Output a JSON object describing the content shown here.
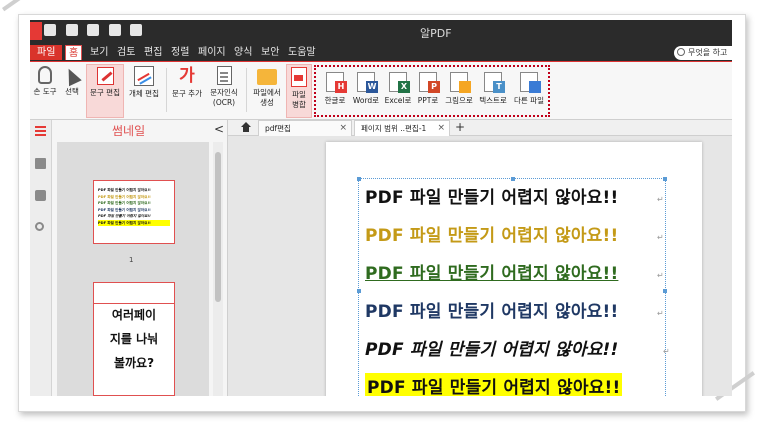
{
  "app": {
    "title": "알PDF"
  },
  "menu": {
    "file": "파일",
    "items": [
      "홈",
      "보기",
      "검토",
      "편집",
      "정렬",
      "페이지",
      "양식",
      "보안",
      "도움말"
    ],
    "active": "홈",
    "search_placeholder": "무엇을 하고"
  },
  "ribbon": {
    "hand_tool": "손 도구",
    "select": "선택",
    "text_edit": "문구 편집",
    "object_edit": "개체 편집",
    "add_text": "문구 추가",
    "ocr_line1": "문자인식",
    "ocr_line2": "(OCR)",
    "create_line1": "파일에서",
    "create_line2": "생성",
    "merge_line1": "파일",
    "merge_line2": "병합",
    "add_text_icon": "가"
  },
  "convert": [
    {
      "label": "한글로",
      "badge": "H",
      "color": "#e53935"
    },
    {
      "label": "Word로",
      "badge": "W",
      "color": "#2b579a"
    },
    {
      "label": "Excel로",
      "badge": "X",
      "color": "#217346"
    },
    {
      "label": "PPT로",
      "badge": "P",
      "color": "#d24726"
    },
    {
      "label": "그림으로",
      "badge": "",
      "color": "#f5a623"
    },
    {
      "label": "텍스트로",
      "badge": "T",
      "color": "#4a90c8"
    },
    {
      "label": "다른 파일",
      "badge": "",
      "color": "#3a7bd5"
    }
  ],
  "thumbnails": {
    "title": "썸네일",
    "page1_number": "1",
    "page1_lines": [
      "PDF 파일 만들기 어렵지 않아요!!",
      "PDF 파일 만들기 어렵지 않아요!!",
      "PDF 파일 만들기 어렵지 않아요!!",
      "PDF 파일 만들기 어렵지 않아요!!",
      "PDF 파일 만들기 어렵지 않아요!!",
      "PDF 파일 만들기 어렵지 않아요!!"
    ],
    "page2_lines": [
      "여러페이",
      "지를 나눠",
      "볼까요?"
    ]
  },
  "tabs": [
    {
      "label": "pdf편집"
    },
    {
      "label": "페이지 범위 ..편집-1"
    }
  ],
  "document": {
    "lines": [
      "PDF 파일 만들기 어렵지 않아요!!",
      "PDF 파일 만들기 어렵지 않아요!!",
      "PDF 파일 만들기 어렵지 않아요!!",
      "PDF 파일 만들기 어렵지 않아요!!",
      "PDF 파일 만들기 어렵지 않아요!!",
      "PDF 파일 만들기 어렵지 않아요!!"
    ],
    "line_colors": [
      "#111111",
      "#c49a17",
      "#2f6b1f",
      "#1f3864",
      "#111111",
      "#111111"
    ]
  }
}
